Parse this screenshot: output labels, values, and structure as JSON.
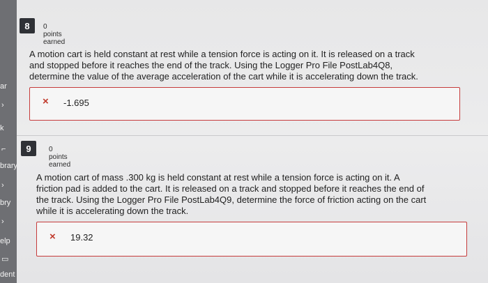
{
  "sidebar": {
    "items": [
      {
        "label": "ar"
      },
      {
        "label": "k"
      },
      {
        "label": "brary"
      },
      {
        "label": "bry"
      },
      {
        "label": "elp"
      },
      {
        "label": "dent"
      }
    ]
  },
  "questions": [
    {
      "number": "8",
      "points": "0 points earned",
      "text_lines": [
        "A motion cart is held constant at rest while a tension force is acting on it. It is released on a track",
        "and stopped before it reaches the end of the track. Using the Logger Pro File PostLab4Q8,",
        "determine the value of the average acceleration of the cart while it is accelerating down the track."
      ],
      "answer": "-1.695"
    },
    {
      "number": "9",
      "points": "0 points earned",
      "text_lines": [
        "A motion cart of mass .300 kg is held constant at rest while a tension force is acting on it. A",
        "friction pad is added to the cart. It is released on a track and stopped before it reaches the end of",
        "the track. Using the Logger Pro File PostLab4Q9, determine the force of friction acting on the cart",
        "while it is accelerating down the track."
      ],
      "answer": "19.32"
    }
  ],
  "colors": {
    "incorrect": "#c0392b",
    "badge": "#2f3136"
  },
  "icons": {
    "incorrect": "close-icon"
  }
}
